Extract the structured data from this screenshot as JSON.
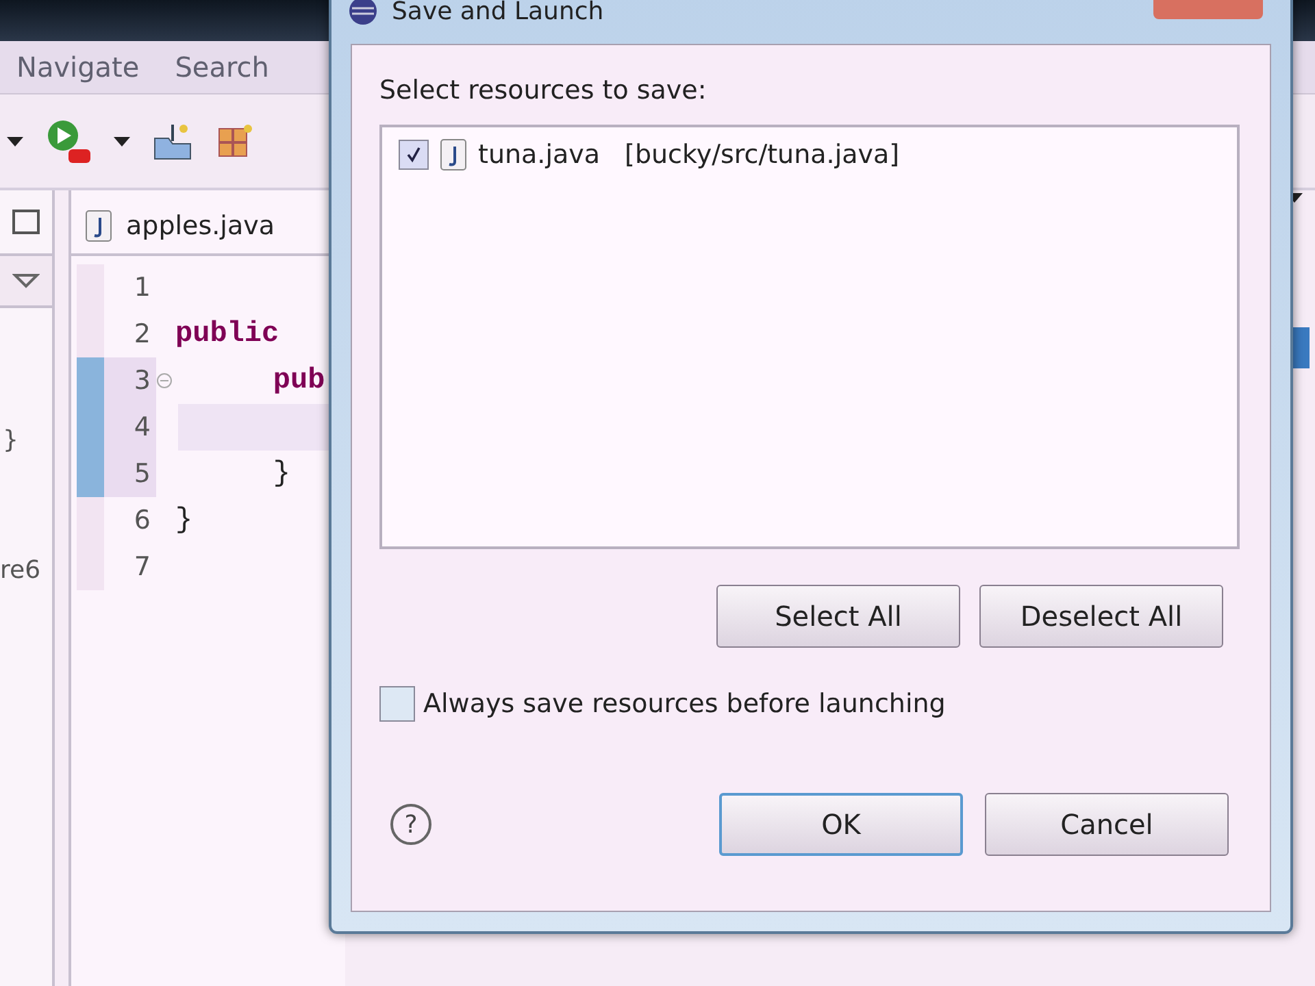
{
  "ide": {
    "menu": [
      "Navigate",
      "Search"
    ],
    "left_panel": [
      "}",
      "re6"
    ],
    "editor": {
      "tab": "apples.java",
      "lines": [
        {
          "number": "1",
          "changed": false
        },
        {
          "number": "2",
          "code": "public",
          "kind": "keyword",
          "changed": false
        },
        {
          "number": "3",
          "code": "pub",
          "kind": "keyword",
          "changed": true
        },
        {
          "number": "4",
          "changed": true
        },
        {
          "number": "5",
          "code": "}",
          "kind": "plain",
          "changed": true
        },
        {
          "number": "6",
          "code": "}",
          "kind": "plain",
          "changed": false
        },
        {
          "number": "7",
          "changed": false
        }
      ]
    }
  },
  "dialog": {
    "title": "Save and Launch",
    "prompt": "Select resources to save:",
    "resources": [
      {
        "name": "tuna.java",
        "path": "[bucky/src/tuna.java]",
        "checked": true
      }
    ],
    "select_all": "Select All",
    "deselect_all": "Deselect All",
    "always_save": {
      "label": "Always save resources before launching",
      "checked": false
    },
    "help": "?",
    "ok": "OK",
    "cancel": "Cancel"
  }
}
